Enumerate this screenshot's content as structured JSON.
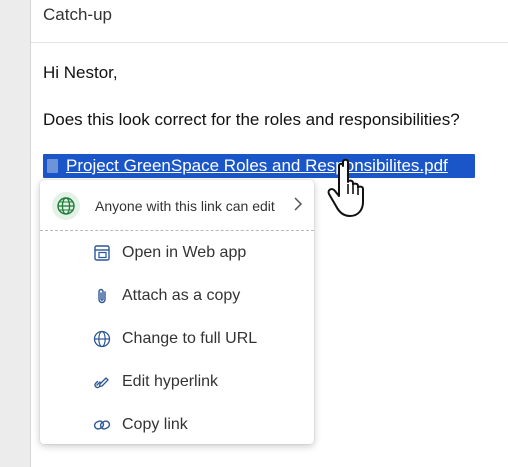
{
  "subject": "Catch-up",
  "body": {
    "greeting": "Hi Nestor,",
    "question": "Does this look correct for the roles and responsibilities?"
  },
  "attachment_link": {
    "text": "Project GreenSpace Roles and Responsibilites.pdf",
    "icon": "document-icon"
  },
  "link_popup": {
    "sharing": {
      "label": "Anyone with this link can edit",
      "icon": "globe-icon",
      "badge_color": "#e2f2e5",
      "icon_color": "#1f7a3a"
    },
    "items": [
      {
        "label": "Open in Web app",
        "icon": "open-web-app-icon"
      },
      {
        "label": "Attach as a copy",
        "icon": "paperclip-icon"
      },
      {
        "label": "Change to full URL",
        "icon": "globe-icon"
      },
      {
        "label": "Edit hyperlink",
        "icon": "edit-link-icon"
      },
      {
        "label": "Copy link",
        "icon": "link-icon"
      }
    ]
  },
  "colors": {
    "selection": "#1b56c9",
    "icon_blue": "#2b5797"
  }
}
